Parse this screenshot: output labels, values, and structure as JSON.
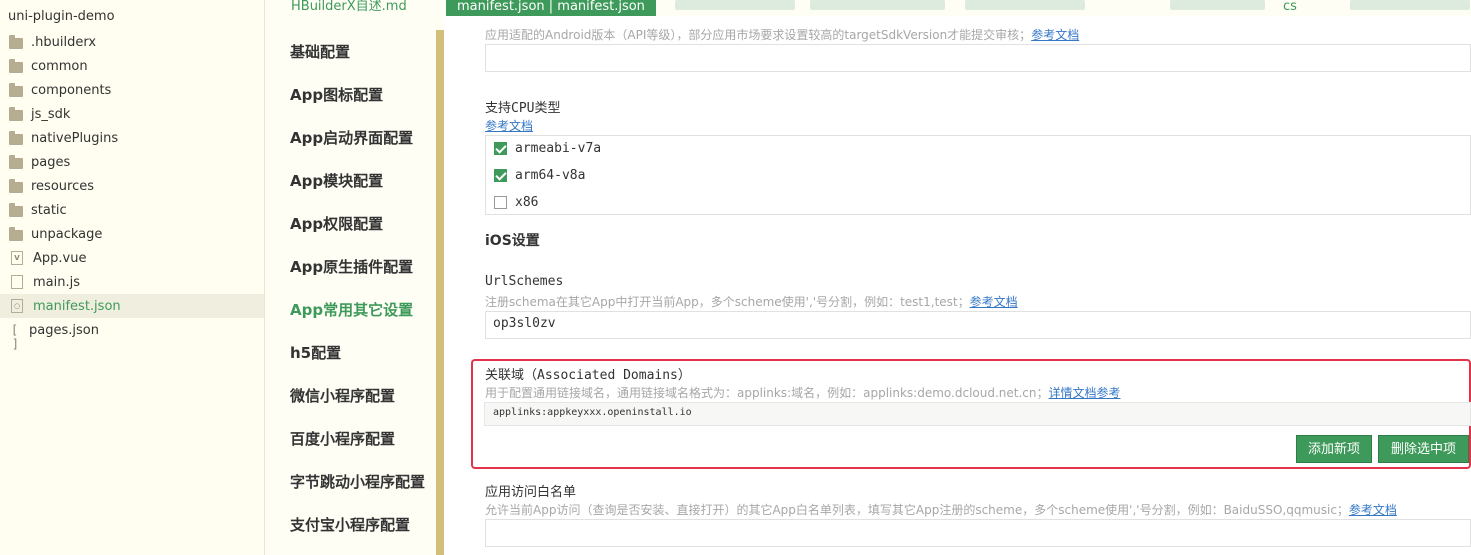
{
  "tree": {
    "project": "uni-plugin-demo",
    "items": [
      {
        "label": ".hbuilderx",
        "type": "folder"
      },
      {
        "label": "common",
        "type": "folder"
      },
      {
        "label": "components",
        "type": "folder"
      },
      {
        "label": "js_sdk",
        "type": "folder"
      },
      {
        "label": "nativePlugins",
        "type": "folder"
      },
      {
        "label": "pages",
        "type": "folder"
      },
      {
        "label": "resources",
        "type": "folder"
      },
      {
        "label": "static",
        "type": "folder"
      },
      {
        "label": "unpackage",
        "type": "folder"
      },
      {
        "label": "App.vue",
        "type": "vue"
      },
      {
        "label": "main.js",
        "type": "file"
      },
      {
        "label": "manifest.json",
        "type": "json",
        "active": true
      },
      {
        "label": "pages.json",
        "type": "bracket"
      }
    ]
  },
  "tabs": {
    "readme": "HBuilderX自述.md",
    "active": "manifest.json | manifest.json",
    "partial_cs": "cs"
  },
  "nav": {
    "items": [
      "基础配置",
      "App图标配置",
      "App启动界面配置",
      "App模块配置",
      "App权限配置",
      "App原生插件配置",
      "App常用其它设置",
      "h5配置",
      "微信小程序配置",
      "百度小程序配置",
      "字节跳动小程序配置",
      "支付宝小程序配置"
    ],
    "active_index": 6
  },
  "main": {
    "sdk_hint": "应用适配的Android版本（API等级），部分应用市场要求设置较高的targetSdkVersion才能提交审核；",
    "sdk_hint_link": "参考文档",
    "cpu_label": "支持CPU类型",
    "cpu_link": "参考文档",
    "cpu_options": [
      {
        "label": "armeabi-v7a",
        "checked": true
      },
      {
        "label": "arm64-v8a",
        "checked": true
      },
      {
        "label": "x86",
        "checked": false
      }
    ],
    "ios_title": "iOS设置",
    "urlschemes_label": "UrlSchemes",
    "urlschemes_hint": "注册schema在其它App中打开当前App，多个scheme使用','号分割，例如：test1,test；",
    "urlschemes_link": "参考文档",
    "urlschemes_value": "op3sl0zv",
    "assoc_label": "关联域（Associated Domains）",
    "assoc_hint": "用于配置通用链接域名，通用链接域名格式为：applinks:域名，例如：applinks:demo.dcloud.net.cn；",
    "assoc_link": "详情文档参考",
    "assoc_value": "applinks:appkeyxxx.openinstall.io",
    "add_button": "添加新项",
    "delete_button": "删除选中项",
    "whitelist_label": "应用访问白名单",
    "whitelist_hint": "允许当前App访问（查询是否安装、直接打开）的其它App白名单列表，填写其它App注册的scheme，多个scheme使用','号分割，例如：BaiduSSO,qqmusic；",
    "whitelist_link": "参考文档"
  },
  "colors": {
    "accent": "#3e9a5a",
    "link": "#3477c7",
    "highlight_border": "#e2334a",
    "scrollbar": "#d3be7a"
  }
}
